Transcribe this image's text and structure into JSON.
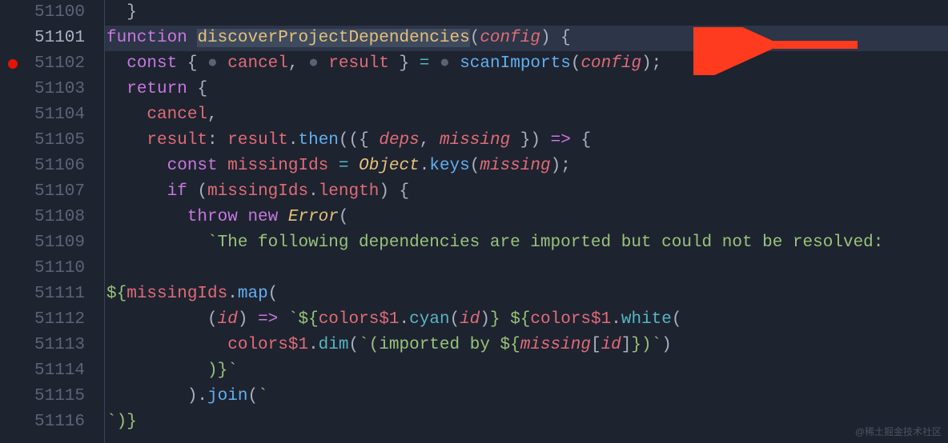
{
  "gutter": {
    "start": 51100,
    "active": 51101,
    "breakpoint": 51102,
    "count": 17
  },
  "code": {
    "l0": "  }",
    "l1_kw1": "function",
    "l1_fn": "discoverProjectDependencies",
    "l1_p": "config",
    "l2_kw": "const",
    "l2_v1": "cancel",
    "l2_v2": "result",
    "l2_fn": "scanImports",
    "l2_arg": "config",
    "l3_kw": "return",
    "l4_v": "cancel",
    "l5_k": "result",
    "l5_v": "result",
    "l5_m": "then",
    "l5_p1": "deps",
    "l5_p2": "missing",
    "l6_kw": "const",
    "l6_v": "missingIds",
    "l6_cls": "Object",
    "l6_m": "keys",
    "l6_arg": "missing",
    "l7_kw": "if",
    "l7_v": "missingIds",
    "l7_p": "length",
    "l8_kw1": "throw",
    "l8_kw2": "new",
    "l8_cls": "Error",
    "l9_str": "`The following dependencies are imported but could not be resolved:",
    "l11_v": "missingIds",
    "l11_m": "map",
    "l12_p": "id",
    "l12_v1": "colors$1",
    "l12_m1": "cyan",
    "l12_a1": "id",
    "l12_v2": "colors$1",
    "l12_m2": "white",
    "l13_v": "colors$1",
    "l13_m": "dim",
    "l13_s1": "`(imported by ",
    "l13_var": "missing",
    "l13_idx": "id",
    "l13_s2": ")`",
    "l14_s": ")}`",
    "l15_m": "join",
    "l15_s": "`",
    "l16_s": "`)}"
  },
  "watermark": "@稀土掘金技术社区"
}
